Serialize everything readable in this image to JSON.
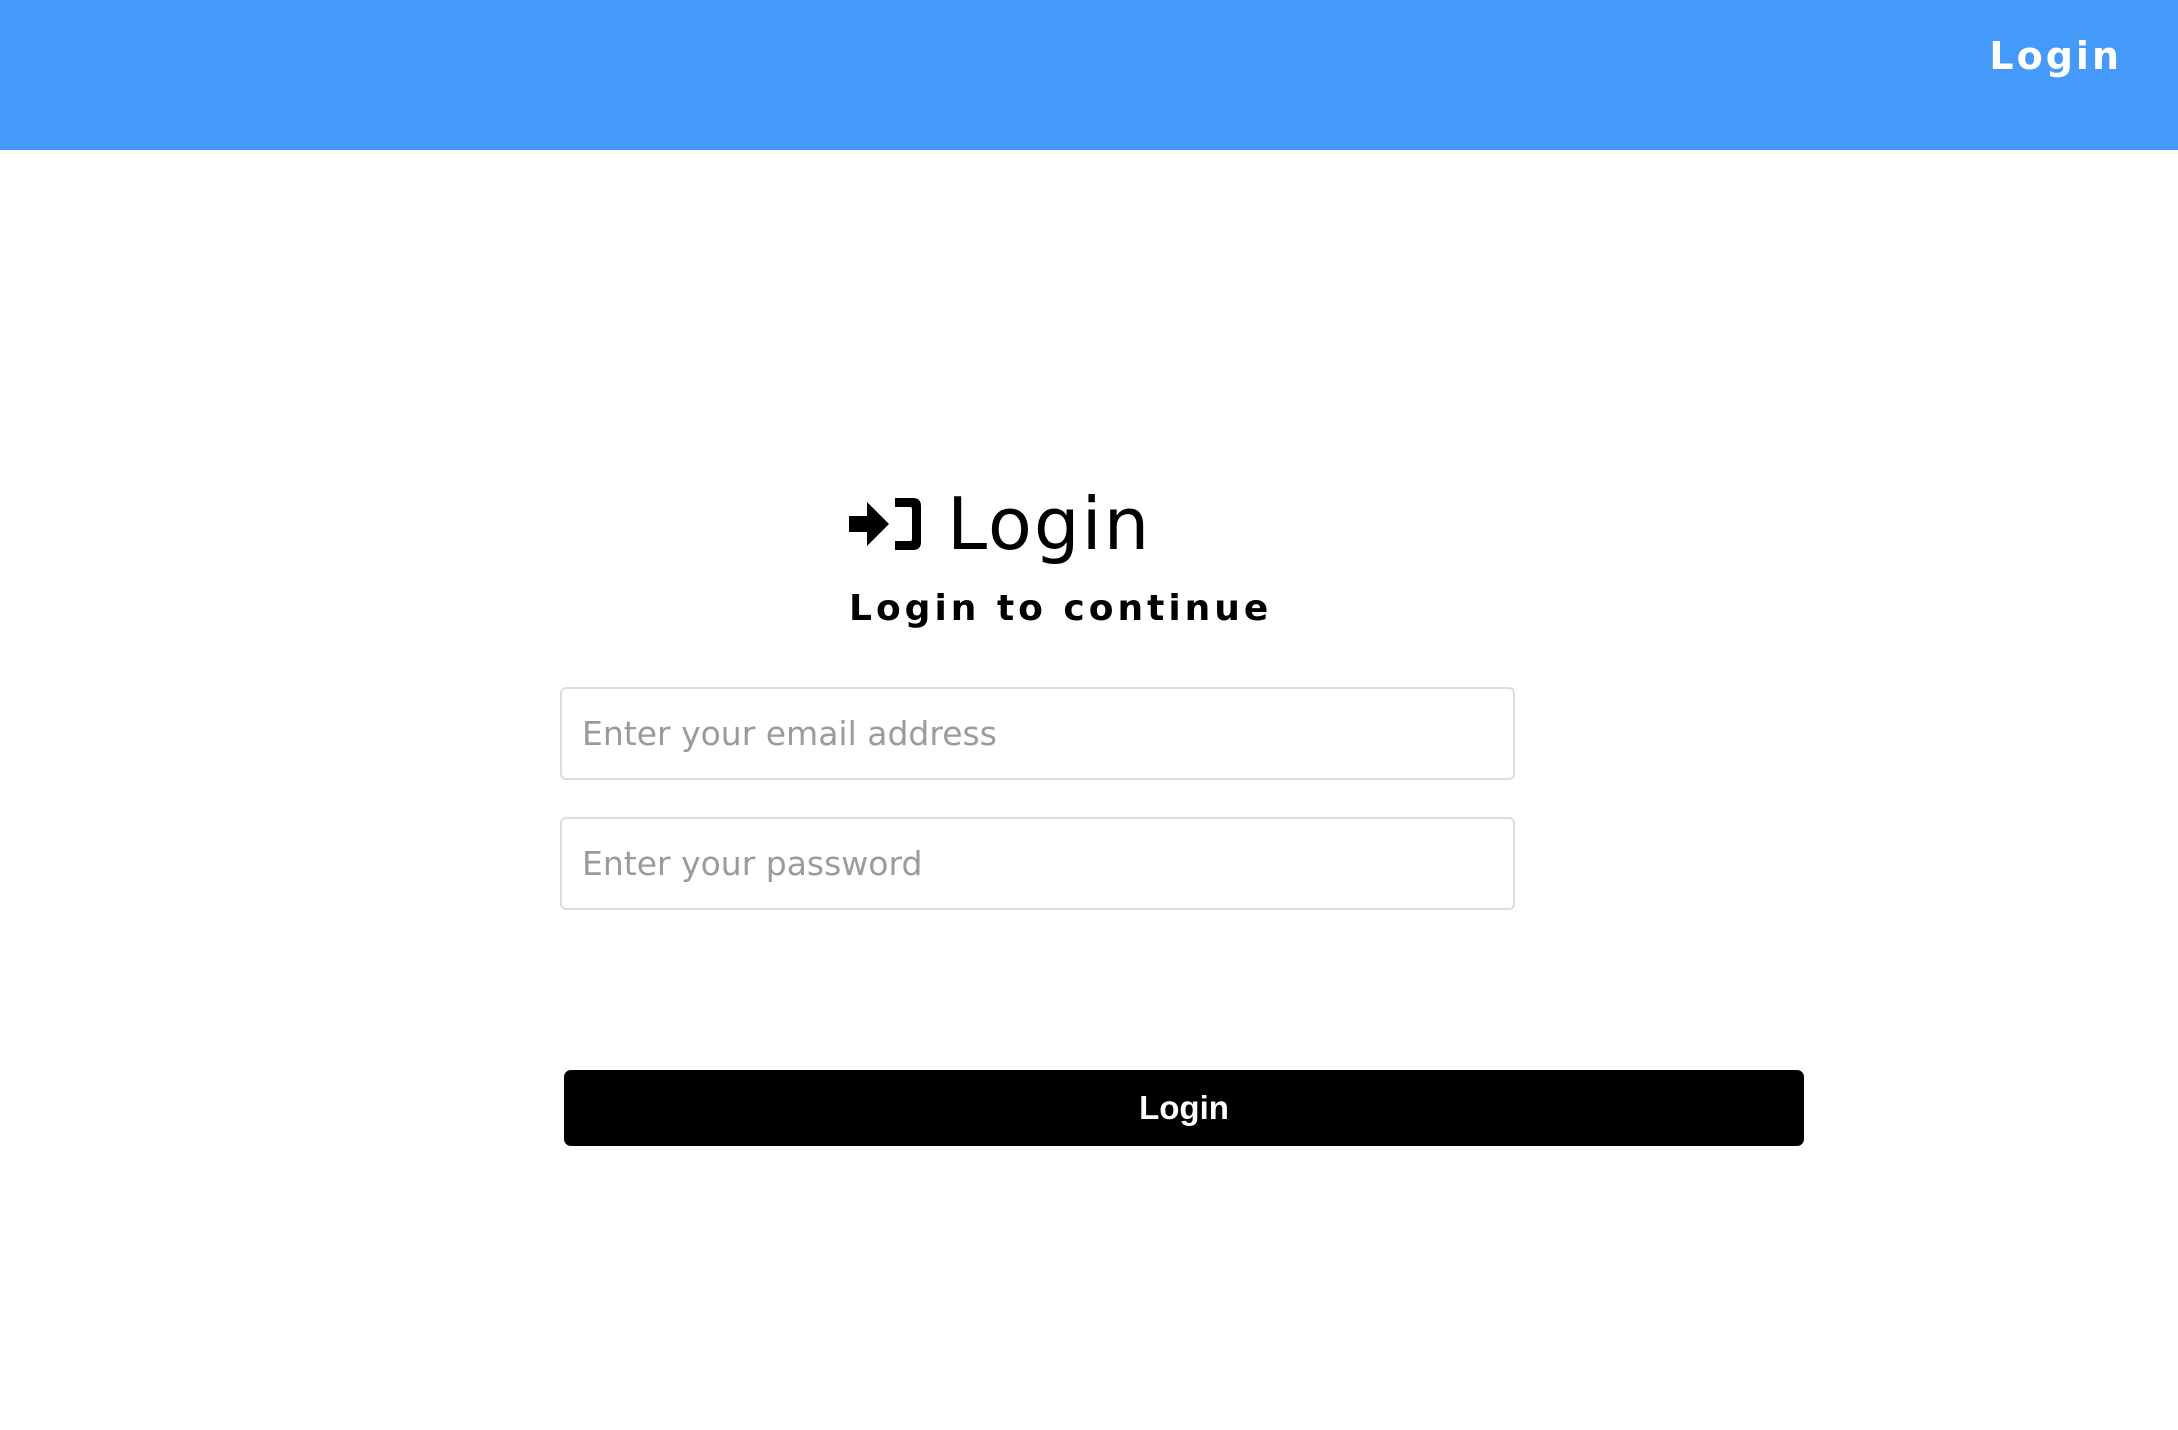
{
  "header": {
    "nav_login_label": "Login",
    "background_color": "#4599f8"
  },
  "login_form": {
    "icon": "sign-in-icon",
    "title": "Login",
    "subtitle": "Login to continue",
    "email_placeholder": "Enter your email address",
    "password_placeholder": "Enter your password",
    "submit_label": "Login"
  }
}
